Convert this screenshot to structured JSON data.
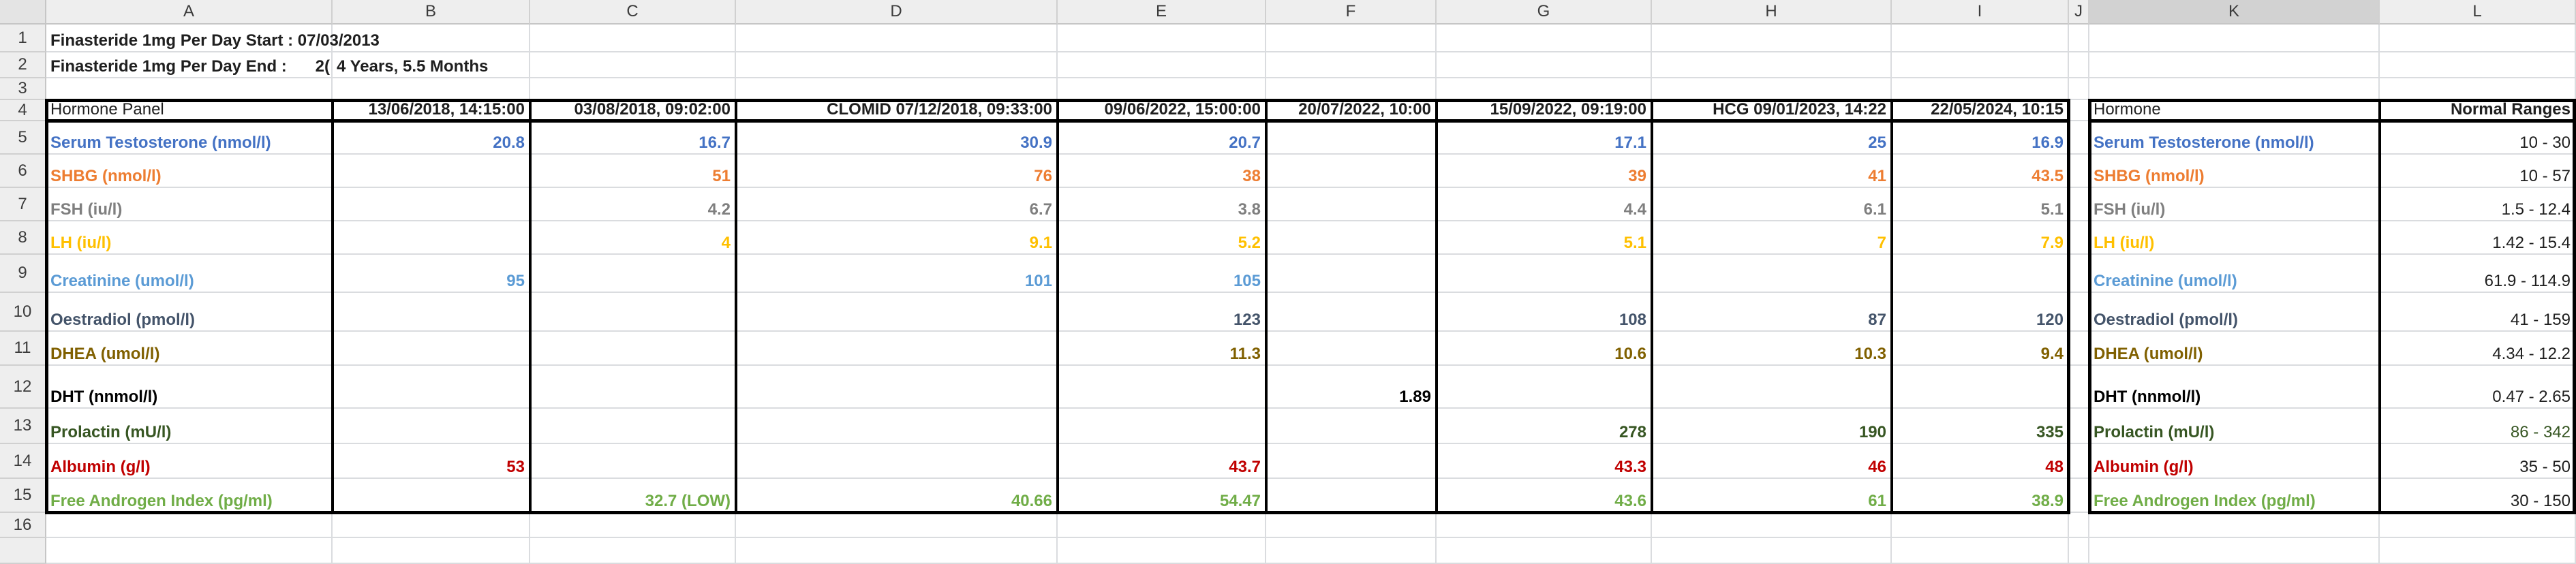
{
  "colors": {
    "testosterone": "#4472c4",
    "shbg": "#ed7d31",
    "fsh": "#7f7f7f",
    "lh": "#ffc000",
    "creatinine": "#5b9bd5",
    "oestradiol": "#44546a",
    "dhea": "#806000",
    "dht": "#000000",
    "prolactin": "#375623",
    "albumin": "#c00000",
    "fai": "#70ad47"
  },
  "columns": [
    "A",
    "B",
    "C",
    "D",
    "E",
    "F",
    "G",
    "H",
    "I",
    "J",
    "K",
    "L"
  ],
  "rows": [
    "1",
    "2",
    "3",
    "4",
    "5",
    "6",
    "7",
    "8",
    "9",
    "10",
    "11",
    "12",
    "13",
    "14",
    "15",
    "16"
  ],
  "header_rows": {
    "start_label": "Finasteride 1mg Per Day Start :  07/03/2013",
    "end_label": "Finasteride 1mg Per Day End :",
    "end_cut": "2(",
    "end_value": "4 Years, 5.5 Months"
  },
  "table": {
    "header": [
      "Hormone Panel",
      "13/06/2018,  14:15:00",
      "03/08/2018,  09:02:00",
      "CLOMID   07/12/2018,  09:33:00",
      "09/06/2022,  15:00:00",
      "20/07/2022, 10:00",
      "15/09/2022,   09:19:00",
      "HCG     09/01/2023, 14:22",
      "22/05/2024, 10:15"
    ],
    "rows": [
      {
        "label": "Serum Testosterone (nmol/l)",
        "color": "testosterone",
        "values": [
          "20.8",
          "16.7",
          "30.9",
          "20.7",
          "",
          "17.1",
          "25",
          "16.9"
        ]
      },
      {
        "label": "SHBG (nmol/l)",
        "color": "shbg",
        "values": [
          "",
          "51",
          "76",
          "38",
          "",
          "39",
          "41",
          "43.5"
        ]
      },
      {
        "label": "FSH (iu/l)",
        "color": "fsh",
        "values": [
          "",
          "4.2",
          "6.7",
          "3.8",
          "",
          "4.4",
          "6.1",
          "5.1"
        ]
      },
      {
        "label": "LH (iu/l)",
        "color": "lh",
        "values": [
          "",
          "4",
          "9.1",
          "5.2",
          "",
          "5.1",
          "7",
          "7.9"
        ]
      },
      {
        "label": "Creatinine (umol/l)",
        "color": "creatinine",
        "values": [
          "95",
          "",
          "101",
          "105",
          "",
          "",
          "",
          ""
        ]
      },
      {
        "label": "Oestradiol (pmol/l)",
        "color": "oestradiol",
        "values": [
          "",
          "",
          "",
          "123",
          "",
          "108",
          "87",
          "120"
        ]
      },
      {
        "label": "DHEA (umol/l)",
        "color": "dhea",
        "values": [
          "",
          "",
          "",
          "11.3",
          "",
          "10.6",
          "10.3",
          "9.4"
        ]
      },
      {
        "label": "DHT (nnmol/l)",
        "color": "dht",
        "values": [
          "",
          "",
          "",
          "",
          "1.89",
          "",
          "",
          ""
        ]
      },
      {
        "label": "Prolactin (mU/l)",
        "color": "prolactin",
        "values": [
          "",
          "",
          "",
          "",
          "",
          "278",
          "190",
          "335"
        ]
      },
      {
        "label": "Albumin (g/l)",
        "color": "albumin",
        "values": [
          "53",
          "",
          "",
          "43.7",
          "",
          "43.3",
          "46",
          "48"
        ]
      },
      {
        "label": "Free Androgen Index (pg/ml)",
        "color": "fai",
        "values": [
          "",
          "32.7 (LOW)",
          "40.66",
          "54.47",
          "",
          "43.6",
          "61",
          "38.9"
        ]
      }
    ]
  },
  "ranges": {
    "header": [
      "Hormone",
      "Normal Ranges"
    ],
    "rows": [
      {
        "label": "Serum Testosterone (nmol/l)",
        "color": "testosterone",
        "range": "10 - 30"
      },
      {
        "label": "SHBG (nmol/l)",
        "color": "shbg",
        "range": "10 - 57"
      },
      {
        "label": "FSH (iu/l)",
        "color": "fsh",
        "range": "1.5 - 12.4"
      },
      {
        "label": "LH (iu/l)",
        "color": "lh",
        "range": "1.42 - 15.4"
      },
      {
        "label": "Creatinine (umol/l)",
        "color": "creatinine",
        "range": "61.9 - 114.9"
      },
      {
        "label": "Oestradiol (pmol/l)",
        "color": "oestradiol",
        "range": "41 - 159"
      },
      {
        "label": "DHEA (umol/l)",
        "color": "dhea",
        "range": "4.34 - 12.2"
      },
      {
        "label": "DHT (nnmol/l)",
        "color": "dht",
        "range": "0.47 - 2.65"
      },
      {
        "label": "Prolactin (mU/l)",
        "color": "prolactin",
        "range": "86 - 342",
        "range_color": "prolactin"
      },
      {
        "label": "Albumin (g/l)",
        "color": "albumin",
        "range": "35 - 50"
      },
      {
        "label": "Free Androgen Index (pg/ml)",
        "color": "fai",
        "range": "30 - 150"
      }
    ]
  }
}
